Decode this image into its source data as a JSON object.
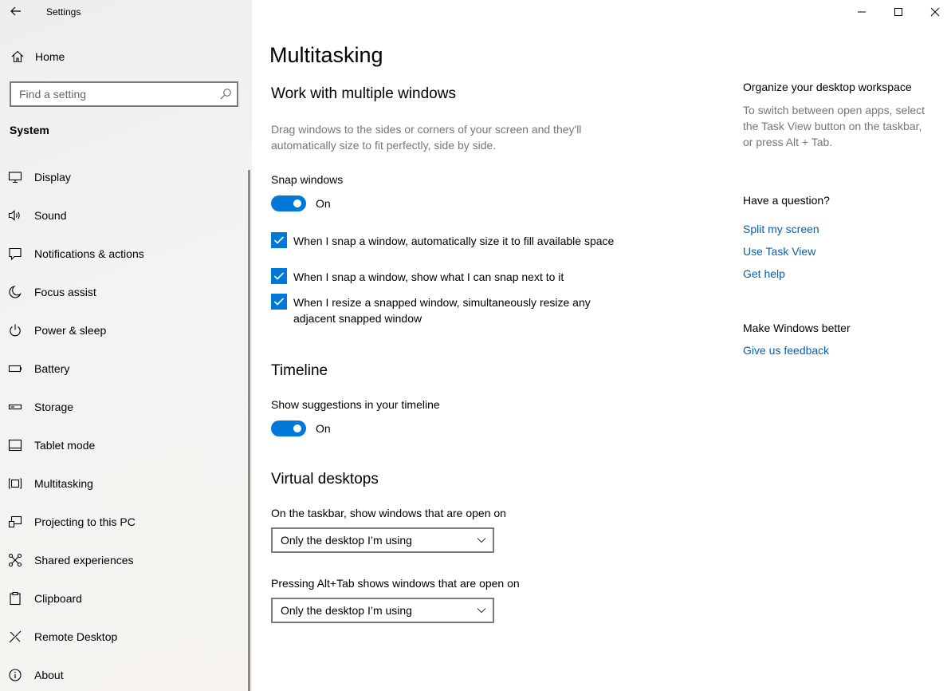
{
  "window": {
    "title": "Settings",
    "controls": [
      "minimize",
      "maximize",
      "close"
    ]
  },
  "sidebar": {
    "home_label": "Home",
    "search_placeholder": "Find a setting",
    "section_label": "System",
    "items": [
      {
        "label": "Display",
        "icon": "monitor-icon"
      },
      {
        "label": "Sound",
        "icon": "speaker-icon"
      },
      {
        "label": "Notifications & actions",
        "icon": "notification-icon"
      },
      {
        "label": "Focus assist",
        "icon": "moon-icon"
      },
      {
        "label": "Power & sleep",
        "icon": "power-icon"
      },
      {
        "label": "Battery",
        "icon": "battery-icon"
      },
      {
        "label": "Storage",
        "icon": "storage-icon"
      },
      {
        "label": "Tablet mode",
        "icon": "tablet-icon"
      },
      {
        "label": "Multitasking",
        "icon": "multitasking-icon"
      },
      {
        "label": "Projecting to this PC",
        "icon": "projecting-icon"
      },
      {
        "label": "Shared experiences",
        "icon": "shared-experiences-icon"
      },
      {
        "label": "Clipboard",
        "icon": "clipboard-icon"
      },
      {
        "label": "Remote Desktop",
        "icon": "remote-desktop-icon"
      },
      {
        "label": "About",
        "icon": "info-icon"
      }
    ],
    "selected": "Multitasking"
  },
  "main": {
    "title": "Multitasking",
    "snap": {
      "heading": "Work with multiple windows",
      "description": "Drag windows to the sides or corners of your screen and they'll automatically size to fit perfectly, side by side.",
      "toggle_label": "Snap windows",
      "toggle_state": "On",
      "toggle_on": true,
      "options": [
        {
          "label": "When I snap a window, automatically size it to fill available space",
          "checked": true
        },
        {
          "label": "When I snap a window, show what I can snap next to it",
          "checked": true
        },
        {
          "label": "When I resize a snapped window, simultaneously resize any adjacent snapped window",
          "checked": true
        }
      ]
    },
    "timeline": {
      "heading": "Timeline",
      "toggle_label": "Show suggestions in your timeline",
      "toggle_state": "On",
      "toggle_on": true
    },
    "virtual_desktops": {
      "heading": "Virtual desktops",
      "taskbar_label": "On the taskbar, show windows that are open on",
      "taskbar_value": "Only the desktop I’m using",
      "alttab_label": "Pressing Alt+Tab shows windows that are open on",
      "alttab_value": "Only the desktop I’m using"
    }
  },
  "aside": {
    "organize_heading": "Organize your desktop workspace",
    "organize_text": "To switch between open apps, select the Task View button on the taskbar, or press Alt + Tab.",
    "question_heading": "Have a question?",
    "links": [
      "Split my screen",
      "Use Task View",
      "Get help"
    ],
    "better_heading": "Make Windows better",
    "feedback_link": "Give us feedback"
  },
  "colors": {
    "accent": "#0078d7",
    "link": "#0063b1",
    "secondary_text": "#767676"
  }
}
